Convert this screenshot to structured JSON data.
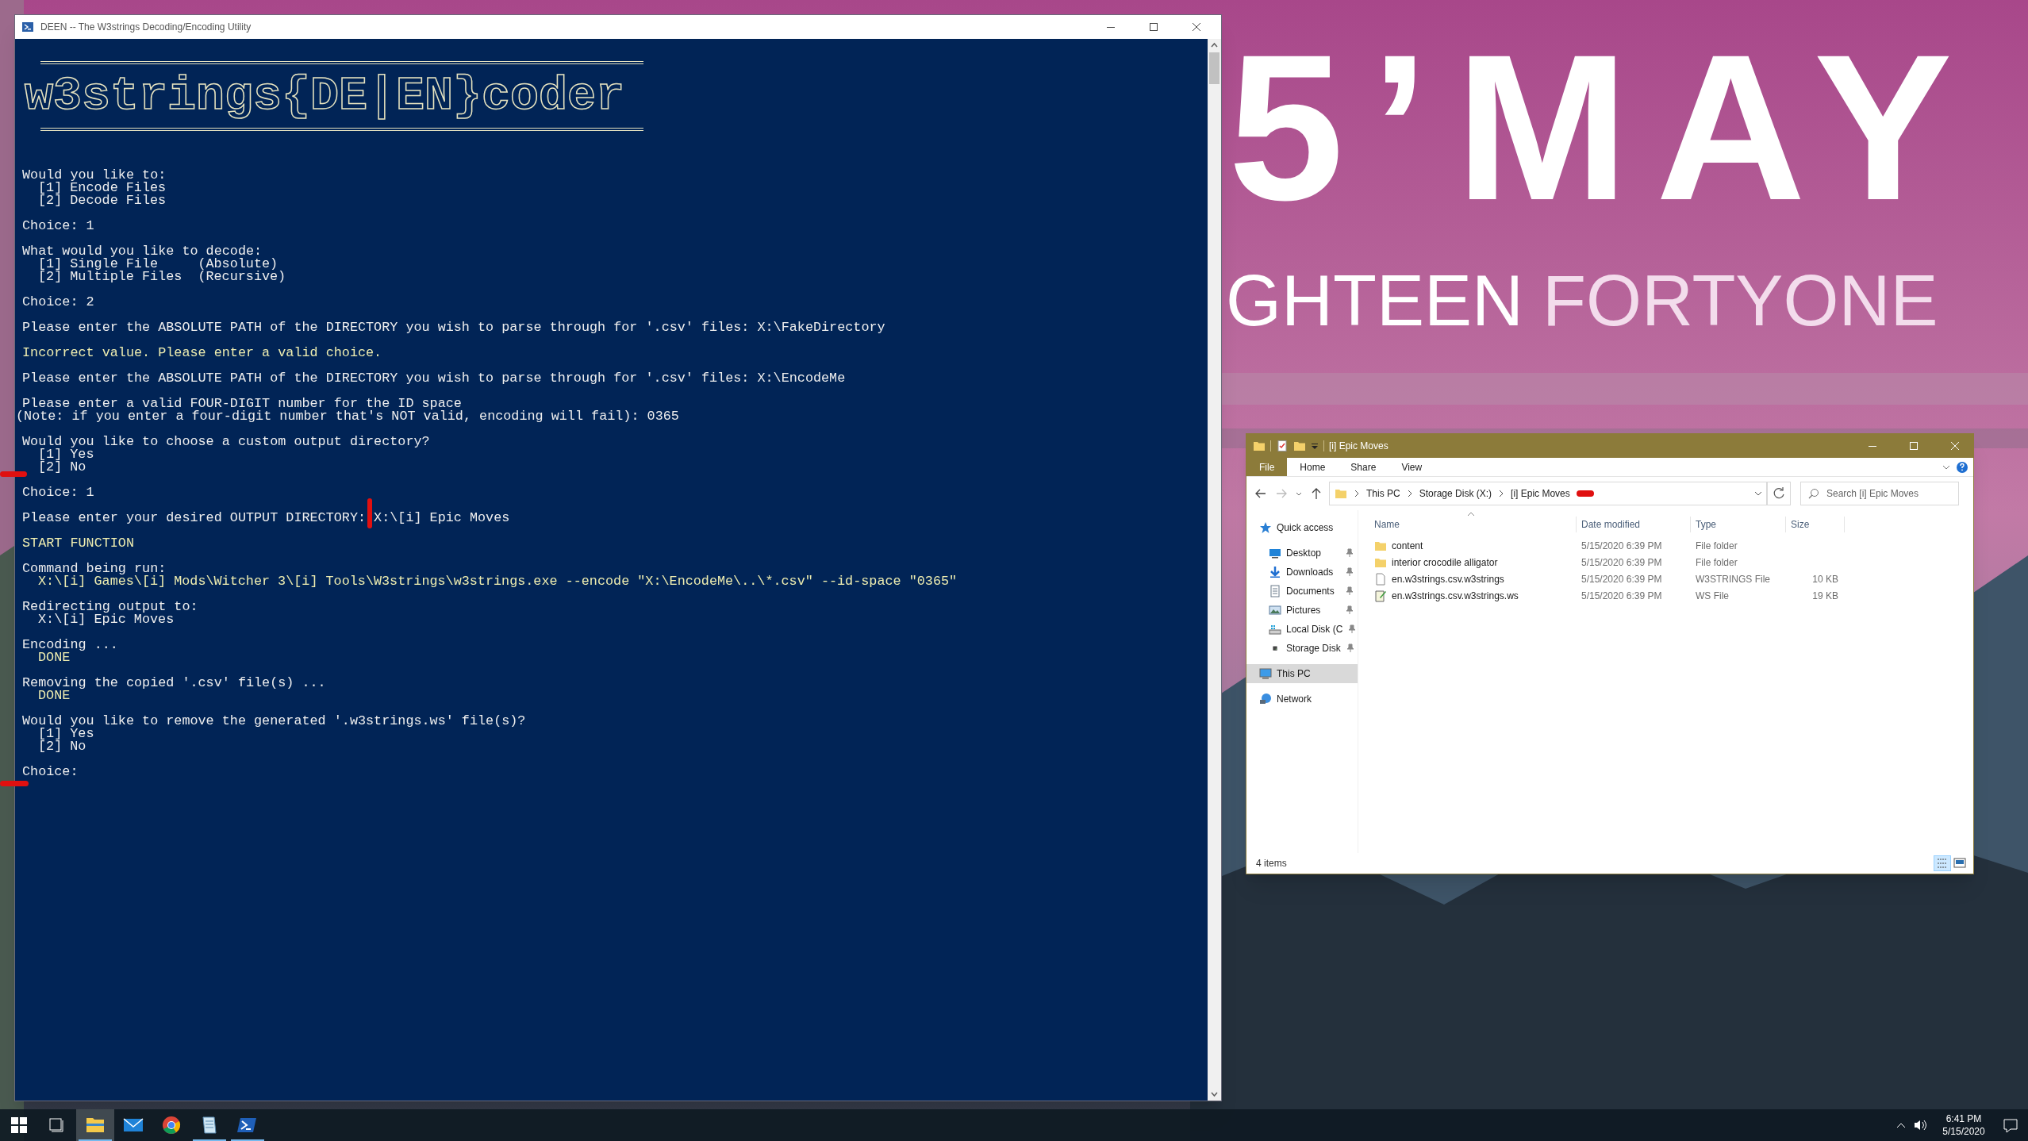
{
  "wallpaper": {
    "kind": "picture",
    "headline": "5’MAY",
    "subtitle": [
      {
        "text": "GHTEEN",
        "kind": "bright"
      },
      {
        "text": "FORTYONE",
        "kind": "soft"
      }
    ]
  },
  "console": {
    "title": "DEEN -- The W3strings Decoding/Encoding Utility",
    "banner": "w3strings{DE|EN}coder",
    "blocks": [
      [
        {
          "text": "Would you like to:",
          "kind": "text",
          "highlight": false
        },
        {
          "text": "[1] Encode Files",
          "kind": "indent",
          "highlight": false
        },
        {
          "text": "[2] Decode Files",
          "kind": "indent",
          "highlight": false
        }
      ],
      [
        {
          "text": "Choice: 1",
          "kind": "text",
          "highlight": false
        }
      ],
      [
        {
          "text": "What would you like to decode:",
          "kind": "text",
          "highlight": false
        },
        {
          "text": "[1] Single File     (Absolute)",
          "kind": "indent",
          "highlight": false
        },
        {
          "text": "[2] Multiple Files  (Recursive)",
          "kind": "indent",
          "highlight": false
        }
      ],
      [
        {
          "text": "Choice: 2",
          "kind": "text",
          "highlight": false
        }
      ],
      [
        {
          "text": "Please enter the ABSOLUTE PATH of the DIRECTORY you wish to parse through for '.csv' files: X:\\FakeDirectory",
          "kind": "text",
          "highlight": false
        }
      ],
      [
        {
          "text": "Incorrect value. Please enter a valid choice.",
          "kind": "text",
          "highlight": true
        }
      ],
      [
        {
          "text": "Please enter the ABSOLUTE PATH of the DIRECTORY you wish to parse through for '.csv' files: X:\\EncodeMe",
          "kind": "text",
          "highlight": false
        }
      ],
      [
        {
          "text": "Please enter a valid FOUR-DIGIT number for the ID space",
          "kind": "text",
          "highlight": false
        },
        {
          "text": "(Note: if you enter a four-digit number that's NOT valid, encoding will fail): 0365",
          "kind": "flush",
          "highlight": false
        }
      ],
      [
        {
          "text": "Would you like to choose a custom output directory?",
          "kind": "text",
          "highlight": false
        },
        {
          "text": "[1] Yes",
          "kind": "indent",
          "highlight": false
        },
        {
          "text": "[2] No",
          "kind": "indent",
          "highlight": false
        }
      ],
      [
        {
          "text": "Choice: 1",
          "kind": "text",
          "highlight": false
        }
      ],
      [
        {
          "text": "Please enter your desired OUTPUT DIRECTORY: X:\\[i] Epic Moves",
          "kind": "text",
          "highlight": false
        }
      ],
      [
        {
          "text": "START FUNCTION",
          "kind": "text",
          "highlight": true
        }
      ],
      [
        {
          "text": "Command being run:",
          "kind": "text",
          "highlight": false
        },
        {
          "text": "X:\\[i] Games\\[i] Mods\\Witcher 3\\[i] Tools\\W3strings\\w3strings.exe --encode \"X:\\EncodeMe\\..\\*.csv\" --id-space \"0365\"",
          "kind": "indent",
          "highlight": true
        }
      ],
      [
        {
          "text": "Redirecting output to:",
          "kind": "text",
          "highlight": false
        },
        {
          "text": "X:\\[i] Epic Moves",
          "kind": "indent",
          "highlight": false
        }
      ],
      [
        {
          "text": "Encoding ...",
          "kind": "text",
          "highlight": false
        },
        {
          "text": "DONE",
          "kind": "indent",
          "highlight": true
        }
      ],
      [
        {
          "text": "Removing the copied '.csv' file(s) ...",
          "kind": "text",
          "highlight": false
        },
        {
          "text": "DONE",
          "kind": "indent",
          "highlight": true
        }
      ],
      [
        {
          "text": "Would you like to remove the generated '.w3strings.ws' file(s)?",
          "kind": "text",
          "highlight": false
        },
        {
          "text": "[1] Yes",
          "kind": "indent",
          "highlight": false
        },
        {
          "text": "[2] No",
          "kind": "indent",
          "highlight": false
        }
      ],
      [
        {
          "text": "Choice:",
          "kind": "text",
          "highlight": false
        }
      ]
    ]
  },
  "explorer": {
    "title": "[i] Epic Moves",
    "ribbon_tabs": [
      {
        "label": "File",
        "selected": true
      },
      {
        "label": "Home",
        "selected": false
      },
      {
        "label": "Share",
        "selected": false
      },
      {
        "label": "View",
        "selected": false
      }
    ],
    "breadcrumbs": [
      "This PC",
      "Storage Disk (X:)",
      "[i] Epic Moves"
    ],
    "search": {
      "placeholder": "Search [i] Epic Moves"
    },
    "nav": [
      {
        "label": "Quick access",
        "kind": "star",
        "selected": false,
        "children": [
          {
            "label": "Desktop",
            "kind": "desktop",
            "pinned": true,
            "selected": false
          },
          {
            "label": "Downloads",
            "kind": "download",
            "pinned": true,
            "selected": false
          },
          {
            "label": "Documents",
            "kind": "document",
            "pinned": true,
            "selected": false
          },
          {
            "label": "Pictures",
            "kind": "pictures",
            "pinned": true,
            "selected": false
          },
          {
            "label": "Local Disk (C",
            "kind": "disk",
            "pinned": true,
            "selected": false
          },
          {
            "label": "Storage Disk",
            "kind": "drive",
            "pinned": true,
            "selected": false
          }
        ]
      },
      {
        "label": "This PC",
        "kind": "pc",
        "selected": true
      },
      {
        "label": "Network",
        "kind": "network",
        "selected": false
      }
    ],
    "columns": [
      "Name",
      "Date modified",
      "Type",
      "Size"
    ],
    "files": [
      {
        "name": "content",
        "kind": "folder",
        "date": "5/15/2020 6:39 PM",
        "type": "File folder"
      },
      {
        "name": "interior crocodile alligator",
        "kind": "folder",
        "date": "5/15/2020 6:39 PM",
        "type": "File folder"
      },
      {
        "name": "en.w3strings.csv.w3strings",
        "kind": "file",
        "date": "5/15/2020 6:39 PM",
        "type": "W3STRINGS File",
        "size": "10 KB"
      },
      {
        "name": "en.w3strings.csv.w3strings.ws",
        "kind": "script",
        "date": "5/15/2020 6:39 PM",
        "type": "WS File",
        "size": "19 KB"
      }
    ],
    "status": "4 items"
  },
  "taskbar": {
    "apps": [
      {
        "kind": "start",
        "selected": false,
        "running": false
      },
      {
        "kind": "taskview",
        "selected": false,
        "running": false
      },
      {
        "kind": "explorer",
        "selected": true,
        "running": true
      },
      {
        "kind": "mail",
        "selected": false,
        "running": false
      },
      {
        "kind": "browser",
        "selected": false,
        "running": false
      },
      {
        "kind": "notepad",
        "selected": false,
        "running": true
      },
      {
        "kind": "terminal",
        "selected": false,
        "running": true
      }
    ],
    "time": "6:41 PM",
    "date": "5/15/2020"
  }
}
